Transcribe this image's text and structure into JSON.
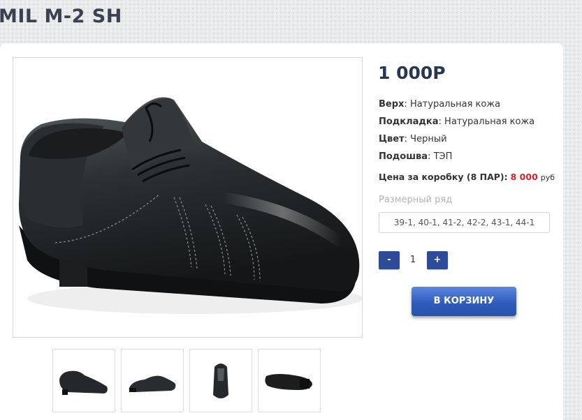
{
  "product": {
    "title": "MIL M-2 SH",
    "price": "1 000Р"
  },
  "specs": [
    {
      "label": "Верх",
      "value": "Натуральная кожа"
    },
    {
      "label": "Подкладка",
      "value": "Натуральная кожа"
    },
    {
      "label": "Цвет",
      "value": "Черный"
    },
    {
      "label": "Подошва",
      "value": "ТЭП"
    }
  ],
  "spec_separator": ": ",
  "box_price": {
    "label": "Цена за коробку (8 ПАР):",
    "value": "8 000",
    "currency": "руб"
  },
  "sizes": {
    "label": "Размерный ряд",
    "selected": "39-1, 40-1, 41-2, 42-2, 43-1, 44-1"
  },
  "quantity": {
    "minus": "-",
    "value": "1",
    "plus": "+"
  },
  "cart_button": "В КОРЗИНУ",
  "gallery": {
    "thumbnail_views": [
      "side",
      "side-angle",
      "front",
      "sole"
    ]
  }
}
